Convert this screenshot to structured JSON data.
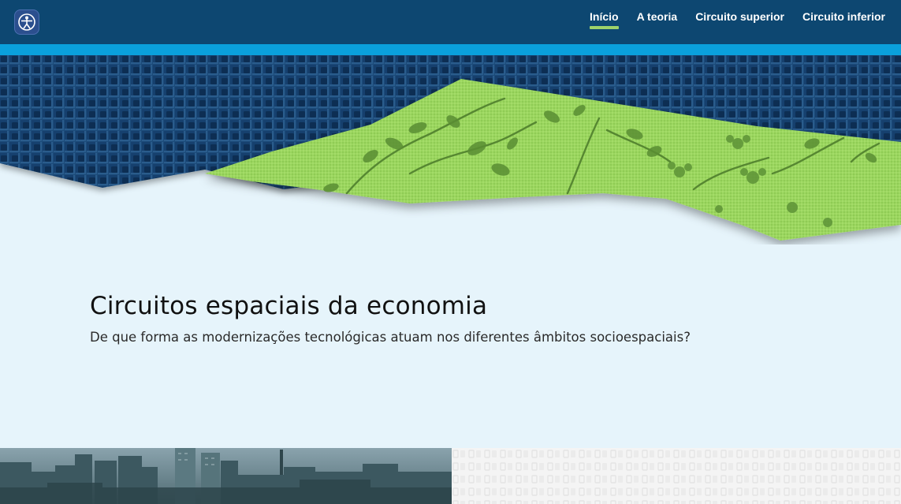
{
  "header": {
    "logo_icon": "vitruvian-man-icon",
    "nav": {
      "items": [
        {
          "label": "Início",
          "active": true
        },
        {
          "label": "A teoria",
          "active": false
        },
        {
          "label": "Circuito superior",
          "active": false
        },
        {
          "label": "Circuito inferior",
          "active": false
        }
      ]
    }
  },
  "hero": {
    "title": "Circuitos espaciais da economia",
    "subtitle": "De que forma as modernizações tecnológicas atuam nos diferentes âmbitos socioespaciais?"
  },
  "colors": {
    "navbar": "#0d4771",
    "accent_strip": "#0aa0dc",
    "active_underline": "#9dd26b",
    "page_background": "#e6f4fb",
    "burlap": "#123f6e",
    "floral_fabric": "#9bd65e"
  }
}
